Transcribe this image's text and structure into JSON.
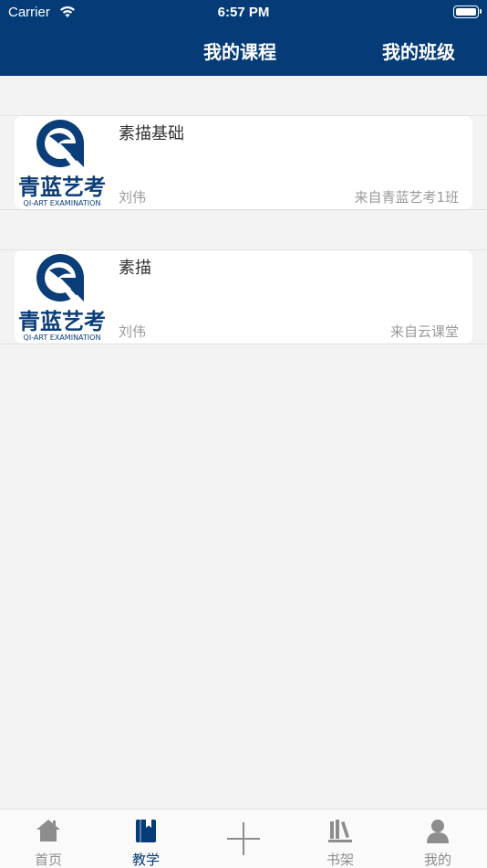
{
  "status_bar": {
    "carrier": "Carrier",
    "time": "6:57 PM"
  },
  "header": {
    "tabs": [
      {
        "label": "我的课程"
      },
      {
        "label": "我的班级"
      }
    ]
  },
  "courses": [
    {
      "title": "素描基础",
      "teacher": "刘伟",
      "source": "来自青蓝艺考1班",
      "logo_text": "青蓝艺考",
      "logo_subtext": "QI-ART EXAMINATION"
    },
    {
      "title": "素描",
      "teacher": "刘伟",
      "source": "来自云课堂",
      "logo_text": "青蓝艺考",
      "logo_subtext": "QI-ART EXAMINATION"
    }
  ],
  "tabbar": {
    "items": [
      {
        "label": "首页",
        "icon": "home-icon",
        "active": false
      },
      {
        "label": "教学",
        "icon": "book-icon",
        "active": true
      },
      {
        "label": "",
        "icon": "plus-icon",
        "active": false
      },
      {
        "label": "书架",
        "icon": "bookshelf-icon",
        "active": false
      },
      {
        "label": "我的",
        "icon": "user-icon",
        "active": false
      }
    ]
  },
  "colors": {
    "header_bg": "#053c78",
    "brand_blue": "#053c78",
    "muted_text": "#9a9a9a",
    "page_bg": "#f3f3f3"
  }
}
